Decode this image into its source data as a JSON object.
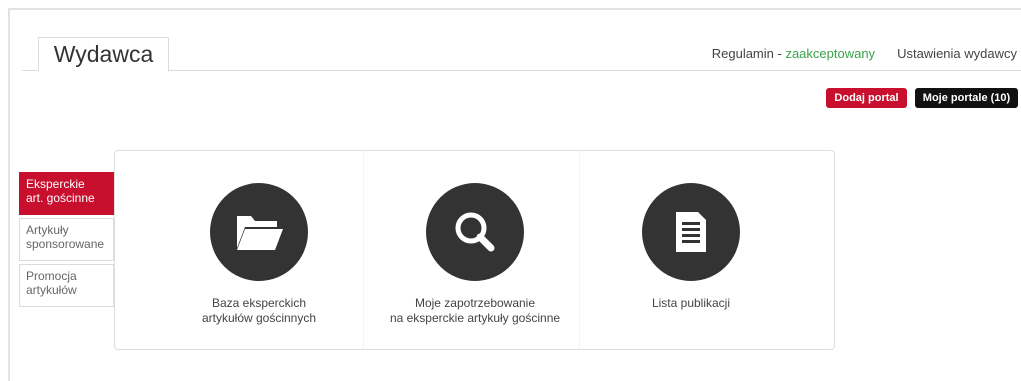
{
  "header": {
    "title": "Wydawca",
    "terms_label": "Regulamin - ",
    "terms_status": "zaakceptowany",
    "settings_link": "Ustawienia wydawcy"
  },
  "actions": {
    "add_portal": "Dodaj portal",
    "my_portals": "Moje portale (10)"
  },
  "sidebar": {
    "items": [
      {
        "line1": "Eksperckie",
        "line2": "art. gościnne"
      },
      {
        "line1": "Artykuły",
        "line2": "sponsorowane"
      },
      {
        "line1": "Promocja",
        "line2": "artykułów"
      }
    ]
  },
  "cards": [
    {
      "icon": "folder-icon",
      "line1": "Baza eksperckich",
      "line2": "artykułów gościnnych"
    },
    {
      "icon": "search-icon",
      "line1": "Moje zapotrzebowanie",
      "line2": "na eksperckie artykuły gościnne"
    },
    {
      "icon": "document-icon",
      "line1": "Lista publikacji",
      "line2": ""
    }
  ],
  "colors": {
    "accent": "#c8102e",
    "accepted": "#3aa34a",
    "dark": "#333333"
  }
}
